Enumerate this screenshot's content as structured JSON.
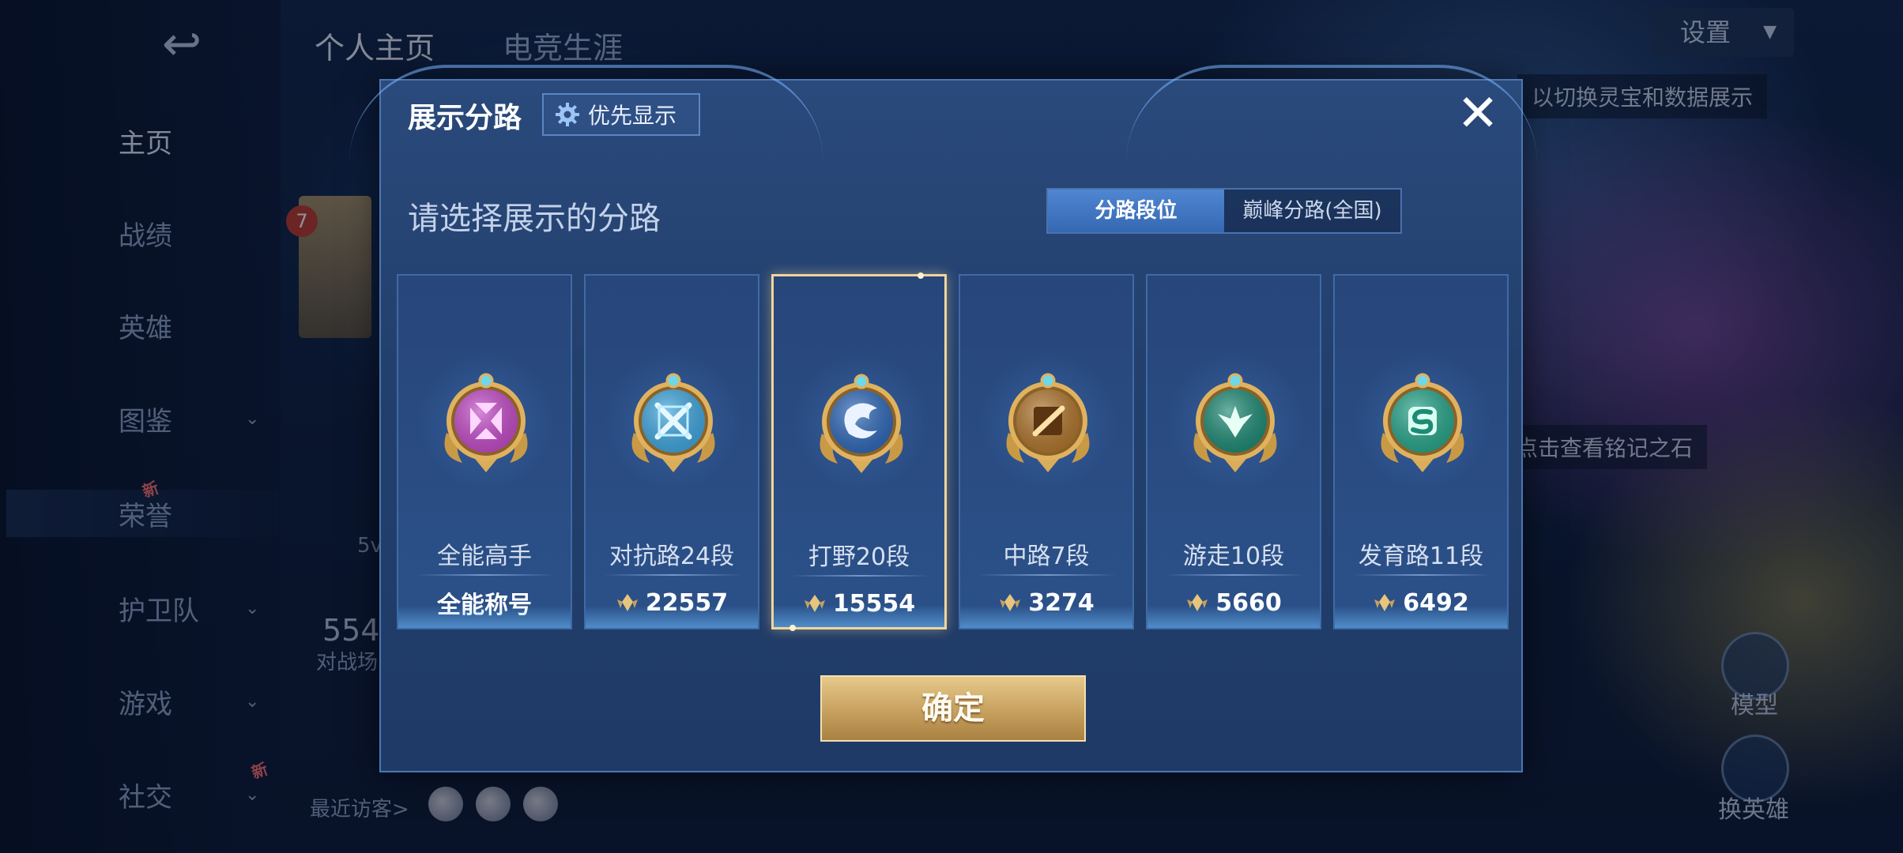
{
  "background": {
    "top_tabs": [
      "个人主页",
      "电竞生涯"
    ],
    "settings_label": "设置",
    "nav_items": [
      {
        "label": "主页",
        "chevron": false,
        "badge": ""
      },
      {
        "label": "战绩",
        "chevron": false,
        "badge": ""
      },
      {
        "label": "英雄",
        "chevron": false,
        "badge": ""
      },
      {
        "label": "图鉴",
        "chevron": true,
        "badge": ""
      },
      {
        "label": "荣誉",
        "chevron": true,
        "badge": "新"
      },
      {
        "label": "护卫队",
        "chevron": true,
        "badge": ""
      },
      {
        "label": "游戏",
        "chevron": true,
        "badge": ""
      },
      {
        "label": "社交",
        "chevron": true,
        "badge": "新"
      }
    ],
    "tip_top": "以切换灵宝和数据展示",
    "tip_mid": "点击查看铭记之石",
    "stat_number": "554",
    "stat_label": "对战场",
    "rank_badge_number": "7",
    "recent_visitors": "最近访客>",
    "right_btn_1": "模型",
    "right_btn_2": "换英雄",
    "small_5v": "5v"
  },
  "dialog": {
    "title": "展示分路",
    "priority_label": "优先显示",
    "prompt": "请选择展示的分路",
    "toggle": [
      "分路段位",
      "巅峰分路(全国)"
    ],
    "toggle_active_index": 0,
    "confirm_label": "确定",
    "close_icon": "close-icon"
  },
  "cards": [
    {
      "role": "全能高手",
      "stat": "全能称号",
      "show_score_icon": false,
      "emblem_color": "#c24bc7",
      "emblem_icon": "all-round-emblem-icon",
      "selected": false
    },
    {
      "role": "对抗路24段",
      "stat": "22557",
      "show_score_icon": true,
      "emblem_color": "#3fa6de",
      "emblem_icon": "clash-lane-emblem-icon",
      "selected": false
    },
    {
      "role": "打野20段",
      "stat": "15554",
      "show_score_icon": true,
      "emblem_color": "#2f68b8",
      "emblem_icon": "jungle-emblem-icon",
      "selected": true
    },
    {
      "role": "中路7段",
      "stat": "3274",
      "show_score_icon": true,
      "emblem_color": "#b0762e",
      "emblem_icon": "mid-lane-emblem-icon",
      "selected": false
    },
    {
      "role": "游走10段",
      "stat": "5660",
      "show_score_icon": true,
      "emblem_color": "#1e8a74",
      "emblem_icon": "roam-emblem-icon",
      "selected": false
    },
    {
      "role": "发育路11段",
      "stat": "6492",
      "show_score_icon": true,
      "emblem_color": "#27a58a",
      "emblem_icon": "farm-lane-emblem-icon",
      "selected": false
    }
  ],
  "colors": {
    "accent_gold": "#caa463",
    "selected_border": "#f0d59a",
    "toggle_active": "#4f86d2",
    "dialog_bg": "#23406d"
  }
}
